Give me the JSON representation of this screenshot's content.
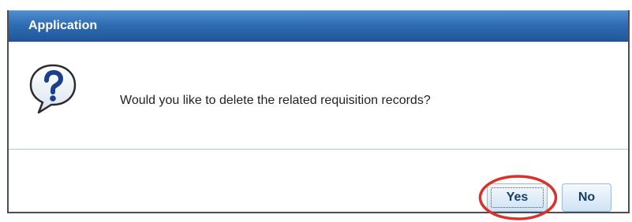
{
  "dialog": {
    "title": "Application",
    "message": "Would you like to delete the related requisition records?",
    "icon": "question-icon",
    "buttons": {
      "yes_label": "Yes",
      "no_label": "No"
    }
  },
  "colors": {
    "title_bar": "#2f6cb3",
    "button_text": "#1a3f66",
    "annotation_ring": "#d9322b"
  }
}
